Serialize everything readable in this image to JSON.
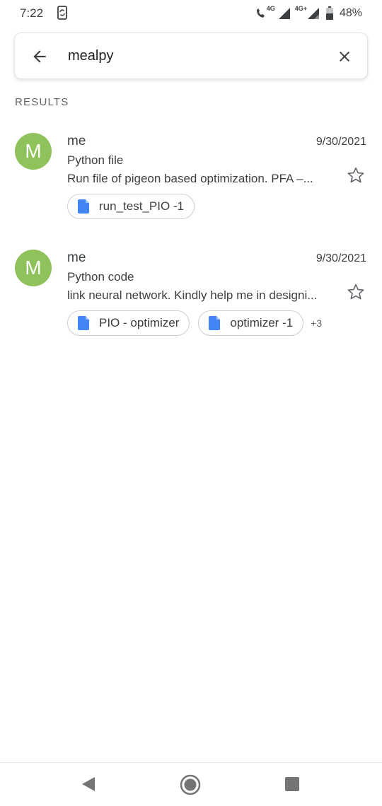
{
  "status_bar": {
    "time": "7:22",
    "network_a": "4G",
    "network_b": "4G+",
    "battery": "48%"
  },
  "search": {
    "query": "mealpy"
  },
  "results_label": "RESULTS",
  "results": [
    {
      "avatar_letter": "M",
      "sender": "me",
      "date": "9/30/2021",
      "subject": "Python file",
      "snippet": "Run file of pigeon based optimization. PFA –...",
      "attachments": [
        "run_test_PIO -1"
      ],
      "more": ""
    },
    {
      "avatar_letter": "M",
      "sender": "me",
      "date": "9/30/2021",
      "subject": "Python code",
      "snippet": "link neural network. Kindly help me in designi...",
      "attachments": [
        "PIO - optimizer",
        "optimizer -1"
      ],
      "more": "+3"
    }
  ],
  "colors": {
    "avatar": "#8fc25a",
    "doc_icon": "#4285f4"
  }
}
